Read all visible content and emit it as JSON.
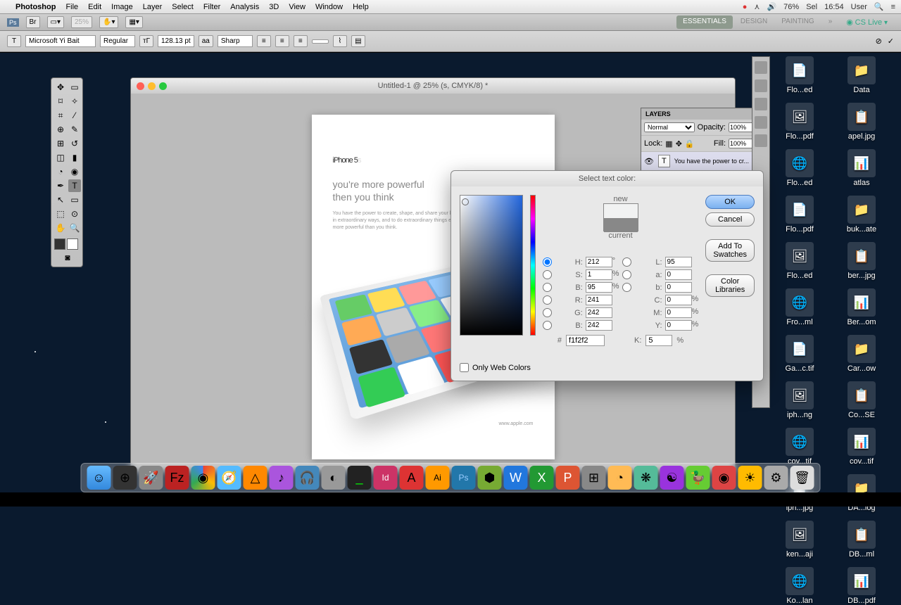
{
  "menubar": {
    "app": "Photoshop",
    "items": [
      "File",
      "Edit",
      "Image",
      "Layer",
      "Select",
      "Filter",
      "Analysis",
      "3D",
      "View",
      "Window",
      "Help"
    ],
    "status": {
      "battery": "76%",
      "day": "Sel",
      "time": "16:54",
      "user": "User"
    }
  },
  "workspace": {
    "active": "ESSENTIALS",
    "others": [
      "DESIGN",
      "PAINTING"
    ],
    "cslive": "CS Live"
  },
  "options": {
    "font": "Microsoft Yi Bait",
    "style": "Regular",
    "size": "128.13 pt",
    "aa": "Sharp"
  },
  "document": {
    "title": "Untitled-1 @ 25% (s, CMYK/8) *"
  },
  "artwork": {
    "headline": "iPhone 5",
    "headline_suffix": "s",
    "subhead": "you're more powerful\nthen you think",
    "body": "You have the power to create, shape, and share your life. The power to do everyday things in extraordinary ways, and to do extraordinary things every day. With iPhone 5s, you're more powerful than you think.",
    "footer": "www.apple.com"
  },
  "layers": {
    "title": "LAYERS",
    "blend": "Normal",
    "opacity_label": "Opacity:",
    "opacity": "100%",
    "lock_label": "Lock:",
    "fill_label": "Fill:",
    "fill": "100%",
    "layer_name": "You have the power to cr..."
  },
  "colorpicker": {
    "title": "Select text color:",
    "ok": "OK",
    "cancel": "Cancel",
    "add": "Add To Swatches",
    "lib": "Color Libraries",
    "new_label": "new",
    "current_label": "current",
    "H": "212",
    "S": "1",
    "Bv": "95",
    "L": "95",
    "a": "0",
    "b": "0",
    "R": "241",
    "G": "242",
    "Bb": "242",
    "C": "0",
    "M": "0",
    "Y": "0",
    "K": "5",
    "hex": "f1f2f2",
    "webonly": "Only Web Colors"
  },
  "desktop_files": [
    "Flo...ed",
    "Data",
    "Flo...pdf",
    "apel.jpg",
    "Flo...ed",
    "atlas",
    "Flo...pdf",
    "buk...ate",
    "Flo...ed",
    "ber...jpg",
    "Fro...ml",
    "Ber...om",
    "Ga...c.tif",
    "Car...ow",
    "iph...ng",
    "Co...SE",
    "cov...tif",
    "cov...tif",
    "iph...jpg",
    "DA...log",
    "ken...aji",
    "DB...ml",
    "Ko...lan",
    "DB...pdf"
  ]
}
